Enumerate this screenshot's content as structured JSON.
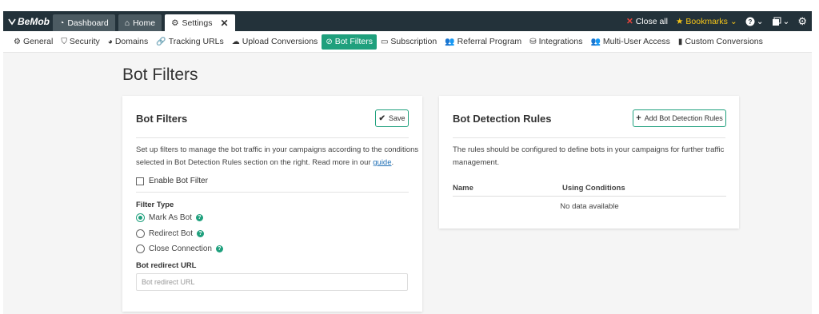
{
  "app": {
    "logo": "BeMob"
  },
  "top_tabs": [
    {
      "label": "Dashboard",
      "icon": "dashboard-icon"
    },
    {
      "label": "Home",
      "icon": "home-icon"
    },
    {
      "label": "Settings",
      "icon": "gear-icon",
      "active": true
    }
  ],
  "top_right": {
    "close_all": "Close all",
    "bookmarks": "Bookmarks"
  },
  "subnav": [
    {
      "label": "General",
      "glyph": "⚙"
    },
    {
      "label": "Security",
      "glyph": "⛉"
    },
    {
      "label": "Domains",
      "glyph": "◕"
    },
    {
      "label": "Tracking URLs",
      "glyph": "🔗"
    },
    {
      "label": "Upload Conversions",
      "glyph": "☁"
    },
    {
      "label": "Bot Filters",
      "glyph": "⊘",
      "active": true
    },
    {
      "label": "Subscription",
      "glyph": "▭"
    },
    {
      "label": "Referral Program",
      "glyph": "👥"
    },
    {
      "label": "Integrations",
      "glyph": "⛁"
    },
    {
      "label": "Multi-User Access",
      "glyph": "👥"
    },
    {
      "label": "Custom Conversions",
      "glyph": "▮"
    }
  ],
  "page": {
    "title": "Bot Filters"
  },
  "bot_filters": {
    "title": "Bot Filters",
    "save_label": "Save",
    "desc_line1": "Set up filters to manage the bot traffic in your campaigns according to the conditions",
    "desc_line2": "selected in Bot Detection Rules section on the right. Read more in our",
    "desc_link": "guide",
    "desc_end": ".",
    "enable_label": "Enable Bot Filter",
    "filter_type_label": "Filter Type",
    "options": [
      {
        "label": "Mark As Bot",
        "checked": true
      },
      {
        "label": "Redirect Bot",
        "checked": false
      },
      {
        "label": "Close Connection",
        "checked": false
      }
    ],
    "url_label": "Bot redirect URL",
    "url_placeholder": "Bot redirect URL"
  },
  "bot_rules": {
    "title": "Bot Detection Rules",
    "add_label": "Add Bot Detection Rules",
    "desc_line1": "The rules should be configured to define bots in your campaigns for further traffic",
    "desc_line2": "management.",
    "col_name": "Name",
    "col_conditions": "Using Conditions",
    "empty": "No data available"
  },
  "colors": {
    "accent": "#1fa07d",
    "topbar": "#23323a",
    "link": "#1f6fb5",
    "bookmark": "#f5c518",
    "close_red": "#e8453c"
  }
}
